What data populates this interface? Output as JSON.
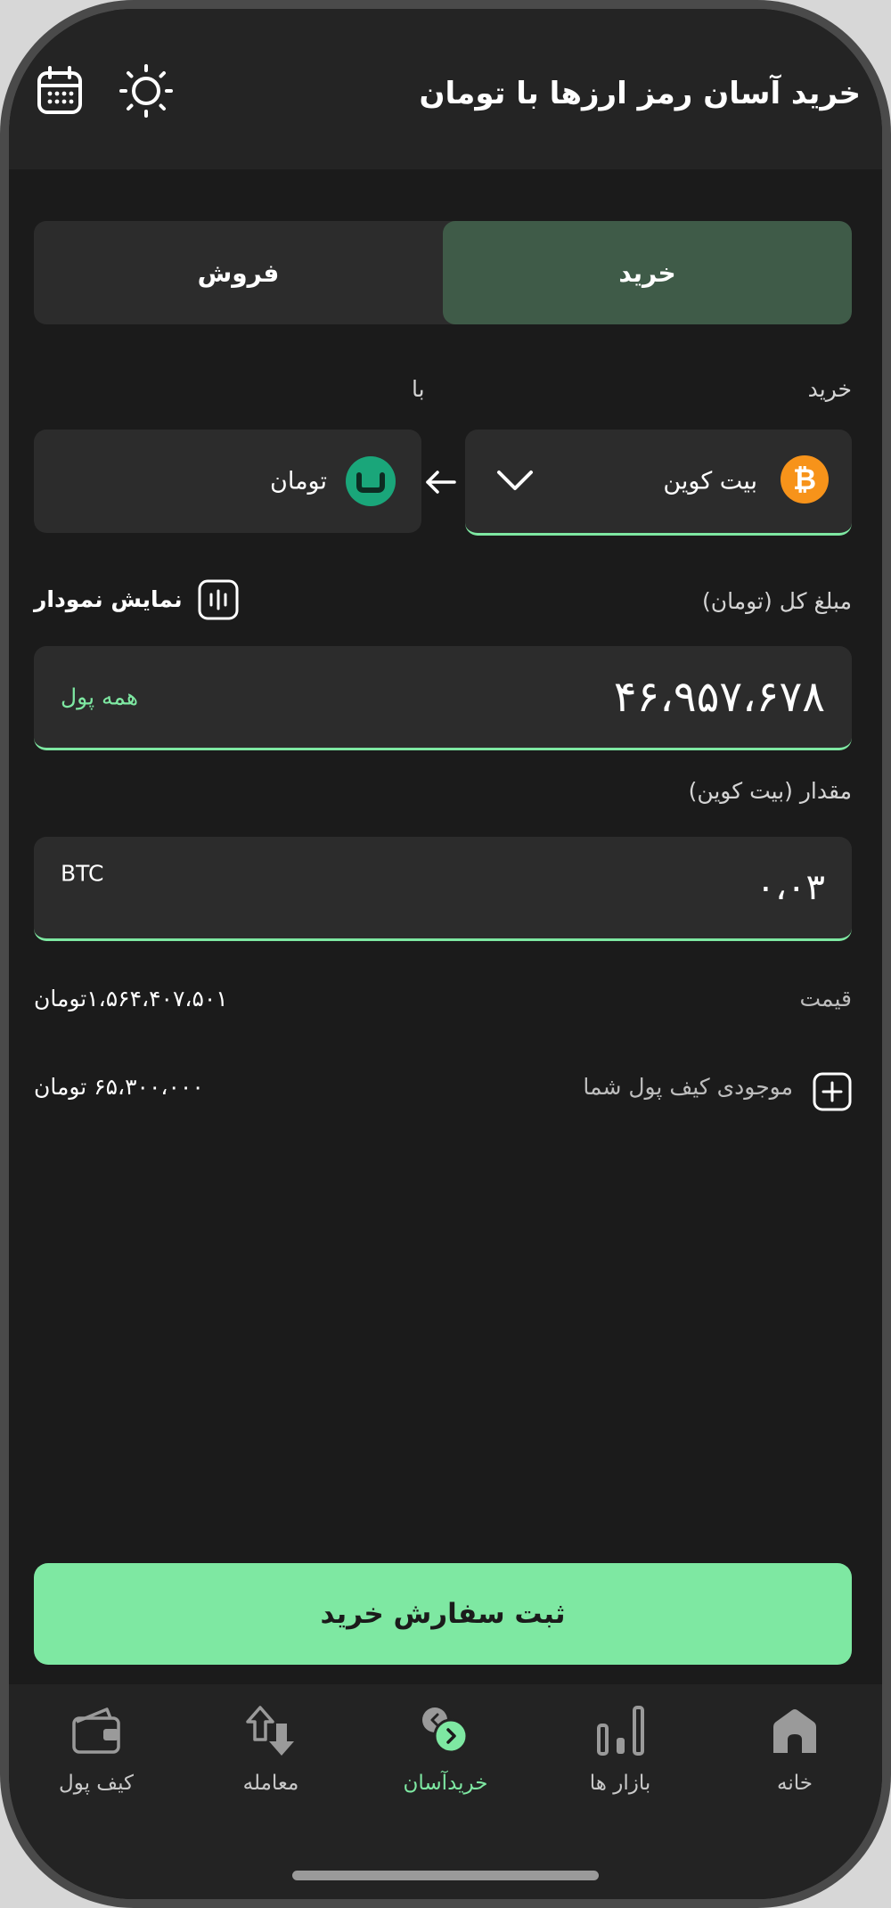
{
  "header": {
    "title": "خرید آسان رمز ارزها با تومان",
    "calendar_icon": "calendar-icon",
    "theme_icon": "sun-icon"
  },
  "tabs": {
    "buy": "خرید",
    "sell": "فروش",
    "active": "buy"
  },
  "pair": {
    "buy_label": "خرید",
    "with_label": "با",
    "from_coin": "بیت کوین",
    "to_coin": "تومان"
  },
  "total": {
    "label": "مبلغ کل (تومان)",
    "chart_toggle": "نمایش نمودار",
    "value": "۴۶،۹۵۷،۶۷۸",
    "all_money": "همه پول"
  },
  "amount": {
    "label": "مقدار (بیت کوین)",
    "value": "۰،۰۳",
    "unit": "BTC"
  },
  "price": {
    "label": "قیمت",
    "value": "۱،۵۶۴،۴۰۷،۵۰۱تومان"
  },
  "wallet": {
    "label": "موجودی کیف پول شما",
    "value": "۶۵،۳۰۰،۰۰۰ تومان"
  },
  "submit_label": "ثبت سفارش خرید",
  "nav": {
    "home": "خانه",
    "markets": "بازار ها",
    "easy_buy": "خریدآسان",
    "trade": "معامله",
    "wallet": "کیف پول",
    "active": "easy_buy"
  },
  "colors": {
    "accent": "#7ee8a2",
    "background": "#1b1b1b",
    "card": "#2c2c2c",
    "active_tab": "#3f5b48",
    "bitcoin": "#f7931a",
    "toman": "#1aa67a"
  }
}
